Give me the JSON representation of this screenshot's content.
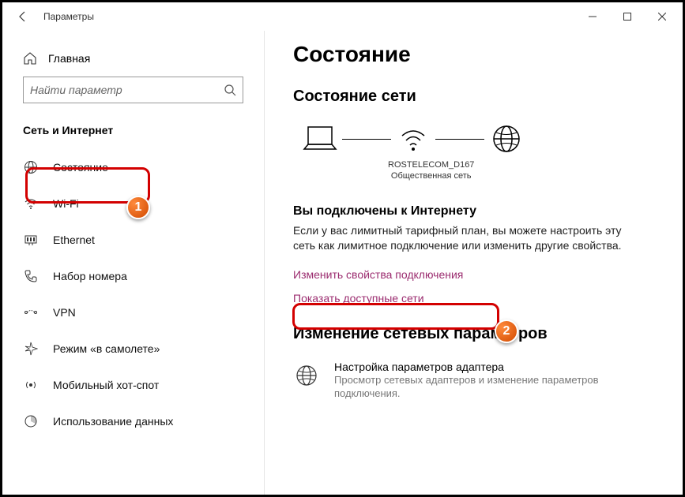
{
  "window": {
    "title": "Параметры"
  },
  "sidebar": {
    "home": "Главная",
    "search_placeholder": "Найти параметр",
    "section": "Сеть и Интернет",
    "items": [
      {
        "label": "Состояние"
      },
      {
        "label": "Wi-Fi"
      },
      {
        "label": "Ethernet"
      },
      {
        "label": "Набор номера"
      },
      {
        "label": "VPN"
      },
      {
        "label": "Режим «в самолете»"
      },
      {
        "label": "Мобильный хот-спот"
      },
      {
        "label": "Использование данных"
      }
    ]
  },
  "content": {
    "page_title": "Состояние",
    "status_title": "Состояние сети",
    "network": {
      "ssid": "ROSTELECOM_D167",
      "type": "Общественная сеть"
    },
    "connected_heading": "Вы подключены к Интернету",
    "connected_desc": "Если у вас лимитный тарифный план, вы можете настроить эту сеть как лимитное подключение или изменить другие свойства.",
    "link_change_props": "Изменить свойства подключения",
    "link_show_networks": "Показать доступные сети",
    "change_params_title": "Изменение сетевых параметров",
    "adapter_opt": {
      "title": "Настройка параметров адаптера",
      "desc": "Просмотр сетевых адаптеров и изменение параметров подключения."
    }
  },
  "callouts": {
    "one": "1",
    "two": "2"
  }
}
